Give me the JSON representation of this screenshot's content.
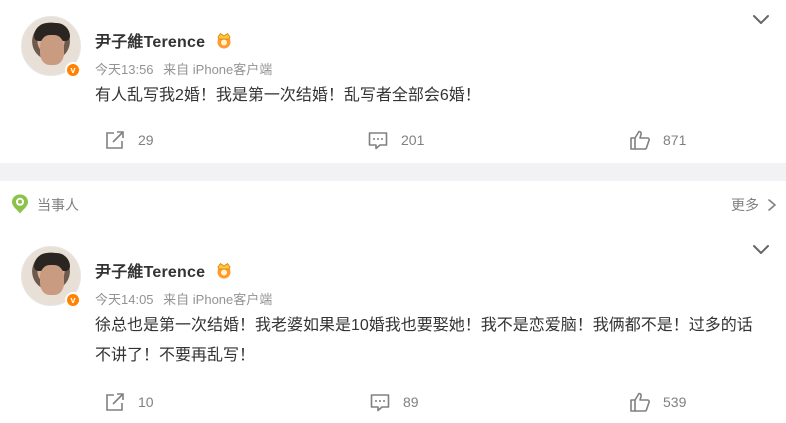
{
  "posts": [
    {
      "author": "尹子維Terence",
      "time": "今天13:56",
      "source": "来自 iPhone客户端",
      "content": "有人乱写我2婚！我是第一次结婚！乱写者全部会6婚！",
      "reposts": "29",
      "comments": "201",
      "likes": "871"
    },
    {
      "author": "尹子維Terence",
      "time": "今天14:05",
      "source": "来自 iPhone客户端",
      "content": "徐总也是第一次结婚！我老婆如果是10婚我也要娶她！我不是恋爱脑！我俩都不是！过多的话不讲了！不要再乱写！",
      "reposts": "10",
      "comments": "89",
      "likes": "539"
    }
  ],
  "party_section": {
    "label": "当事人",
    "more": "更多"
  },
  "colors": {
    "accent": "#ff8200",
    "text": "#333333",
    "muted": "#939393",
    "divider": "#f2f2f5",
    "pin": "#8bc34a"
  },
  "icons": [
    "verified-badge-icon",
    "crown-icon",
    "chevron-down-icon",
    "repost-icon",
    "comment-icon",
    "like-icon",
    "location-pin-icon",
    "chevron-right-icon"
  ]
}
